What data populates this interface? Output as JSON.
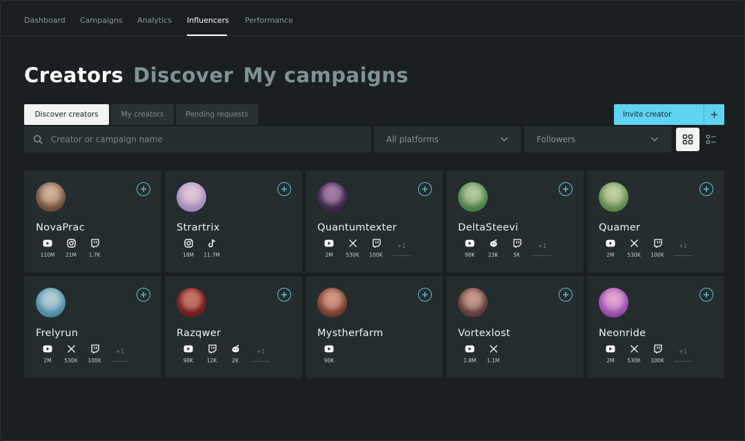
{
  "nav": {
    "items": [
      "Dashboard",
      "Campaigns",
      "Analytics",
      "Influencers",
      "Performance"
    ],
    "active_index": 3
  },
  "title": {
    "primary": "Creators",
    "secondary": "Discover",
    "tertiary": "My campaigns"
  },
  "tabs": [
    "Discover creators",
    "My creators",
    "Pending requests"
  ],
  "invite": {
    "label": "Invite creator",
    "plus": "+"
  },
  "search": {
    "placeholder": "Creator or campaign name",
    "value": ""
  },
  "filters": {
    "platform": "All platforms",
    "sort": "Followers"
  },
  "colors": {
    "accent": "#5fd3ef",
    "card_bg": "#242c2e",
    "page_bg": "#1a1f21"
  },
  "creators": [
    {
      "name": "NovaPrac",
      "stats": [
        {
          "platform": "youtube-icon",
          "value": "110M"
        },
        {
          "platform": "instagram-icon",
          "value": "21M"
        },
        {
          "platform": "twitch-icon",
          "value": "1.7K"
        }
      ],
      "more": ""
    },
    {
      "name": "Strartrix",
      "stats": [
        {
          "platform": "instagram-icon",
          "value": "18M"
        },
        {
          "platform": "tiktok-icon",
          "value": "11.7M"
        }
      ],
      "more": ""
    },
    {
      "name": "Quantumtexter",
      "stats": [
        {
          "platform": "youtube-icon",
          "value": "2M"
        },
        {
          "platform": "x-icon",
          "value": "530K"
        },
        {
          "platform": "twitch-icon",
          "value": "100K"
        }
      ],
      "more": "+1"
    },
    {
      "name": "DeltaSteevi",
      "stats": [
        {
          "platform": "youtube-icon",
          "value": "98K"
        },
        {
          "platform": "reddit-icon",
          "value": "23K"
        },
        {
          "platform": "twitch-icon",
          "value": "5K"
        }
      ],
      "more": "+1"
    },
    {
      "name": "Quamer",
      "stats": [
        {
          "platform": "youtube-icon",
          "value": "2M"
        },
        {
          "platform": "x-icon",
          "value": "530K"
        },
        {
          "platform": "twitch-icon",
          "value": "100K"
        }
      ],
      "more": "+1"
    },
    {
      "name": "Frelyrun",
      "stats": [
        {
          "platform": "youtube-icon",
          "value": "2M"
        },
        {
          "platform": "x-icon",
          "value": "530K"
        },
        {
          "platform": "twitch-icon",
          "value": "100K"
        }
      ],
      "more": "+1"
    },
    {
      "name": "Razqwer",
      "stats": [
        {
          "platform": "youtube-icon",
          "value": "98K"
        },
        {
          "platform": "twitch-icon",
          "value": "12K"
        },
        {
          "platform": "reddit-icon",
          "value": "2K"
        }
      ],
      "more": "+1"
    },
    {
      "name": "Mystherfarm",
      "stats": [
        {
          "platform": "youtube-icon",
          "value": "90K"
        }
      ],
      "more": ""
    },
    {
      "name": "Vortexlost",
      "stats": [
        {
          "platform": "youtube-icon",
          "value": "1.8M"
        },
        {
          "platform": "x-icon",
          "value": "1.1M"
        }
      ],
      "more": ""
    },
    {
      "name": "Neonride",
      "stats": [
        {
          "platform": "youtube-icon",
          "value": "2M"
        },
        {
          "platform": "x-icon",
          "value": "530K"
        },
        {
          "platform": "twitch-icon",
          "value": "100K"
        }
      ],
      "more": "+1"
    }
  ]
}
